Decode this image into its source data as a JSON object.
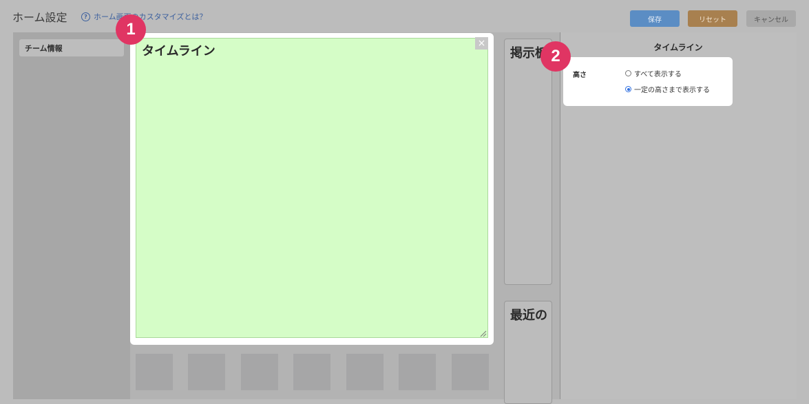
{
  "header": {
    "title": "ホーム設定",
    "help_link": "ホーム画面のカスタマイズとは？",
    "help_icon": "?",
    "buttons": {
      "save": "保存",
      "reset": "リセット",
      "cancel": "キャンセル"
    }
  },
  "sidebar": {
    "items": [
      {
        "label": "チーム情報"
      }
    ]
  },
  "main": {
    "timeline_widget": {
      "title": "タイムライン",
      "close_icon": "×"
    },
    "widgets": [
      {
        "title": "掲示板"
      },
      {
        "title": "最近の"
      }
    ],
    "placeholder_count": 7
  },
  "right_panel": {
    "title": "タイムライン",
    "height_label": "高さ",
    "options": [
      {
        "label": "すべて表示する",
        "selected": false
      },
      {
        "label": "一定の高さまで表示する",
        "selected": true
      }
    ]
  },
  "badges": [
    "1",
    "2"
  ],
  "colors": {
    "save": "#5b8dc4",
    "reset": "#a8804f",
    "cancel": "#a9a9a9",
    "timeline_bg": "#d5fdc7",
    "badge": "#e03563",
    "radio_selected": "#2f6fe0"
  }
}
